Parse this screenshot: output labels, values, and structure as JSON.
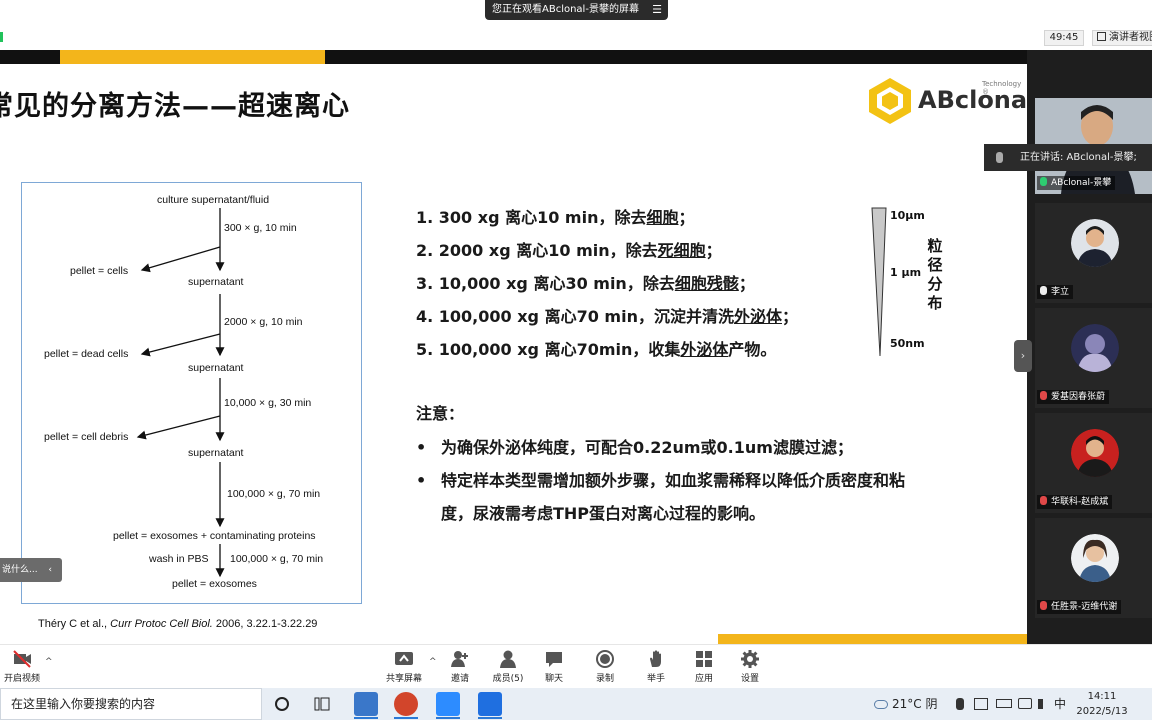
{
  "zoom": {
    "banner_text": "您正在观看ABclonal-景攀的屏幕",
    "banner_menu": "☰",
    "timer": "49:45",
    "speaker_view_label": "演讲者视图"
  },
  "slide": {
    "title": "常见的分离方法——超速离心",
    "logo_name": "ABclonal",
    "logo_tech": "Technology ®",
    "flowchart": {
      "culture": "culture supernatant/fluid",
      "cond1": "300 × g, 10 min",
      "pellet1": "pellet = cells",
      "sup1": "supernatant",
      "cond2": "2000 × g, 10 min",
      "pellet2": "pellet = dead cells",
      "sup2": "supernatant",
      "cond3": "10,000 × g, 30 min",
      "pellet3": "pellet = cell debris",
      "sup3": "supernatant",
      "cond4": "100,000 × g, 70 min",
      "pellet4": "pellet = exosomes + contaminating proteins",
      "wash": "wash in PBS",
      "cond5": "100,000 × g, 70 min",
      "pellet5": "pellet = exosomes"
    },
    "citation": {
      "authors": "Théry C et al., ",
      "journal": "Curr Protoc Cell Biol.",
      "ref": " 2006, 3.22.1-3.22.29"
    },
    "steps": [
      {
        "pre": "1. 300 xg 离心10 min，除去",
        "u": "细胞",
        "post": "；"
      },
      {
        "pre": "2. 2000 xg 离心10 min，除去",
        "u": "死细胞",
        "post": "；"
      },
      {
        "pre": "3. 10,000 xg 离心30 min，除去",
        "u": "细胞残骸",
        "post": "；"
      },
      {
        "pre": "4. 100,000 xg 离心70 min，沉淀并清洗",
        "u": "外泌体",
        "post": "；"
      },
      {
        "pre": "5. 100,000 xg 离心70min，收集",
        "u": "外泌体",
        "post": "产物。"
      }
    ],
    "note_title": "注意：",
    "bullets": [
      {
        "dot": "•",
        "text": "为确保外泌体纯度，可配合0.22um或0.1um滤膜过滤；"
      },
      {
        "dot": "•",
        "text": "特定样本类型需增加额外步骤，如血浆需稀释以降低介质密度和粘"
      },
      {
        "dot": "",
        "text": "度，尿液需考虑THP蛋白对离心过程的影响。"
      }
    ],
    "scale": {
      "top": "10μm",
      "mid": "1 μm",
      "bottom": "50nm",
      "label": "粒径分布"
    },
    "side_tab": "说什么...",
    "side_tab_chev": "‹"
  },
  "panel": {
    "speaking_text": "正在讲话: ABclonal-景攀;",
    "collapse": "›",
    "participants": [
      {
        "name": "ABclonal-景攀",
        "mic": "on"
      },
      {
        "name": "李立",
        "mic": "normal"
      },
      {
        "name": "爱基因春张蔚",
        "mic": "off"
      },
      {
        "name": "华联科-赵成斌",
        "mic": "off"
      },
      {
        "name": "任胜景-迈维代谢",
        "mic": "off"
      }
    ]
  },
  "toolbar": {
    "start_video": "开启视频",
    "share": "共享屏幕",
    "invite": "邀请",
    "members": "成员(5)",
    "chat": "聊天",
    "record": "录制",
    "raise": "举手",
    "apps": "应用",
    "settings": "设置",
    "caret": "^"
  },
  "taskbar": {
    "search_placeholder": "在这里输入你要搜索的内容",
    "weather": "21°C 阴",
    "ime": "中",
    "time": "14:11",
    "date": "2022/5/13"
  },
  "colors": {
    "gold": "#f3b51b",
    "dark_bar": "#111111",
    "panel_bg": "#1e1e1e",
    "frame_blue": "#7ea8d6"
  }
}
